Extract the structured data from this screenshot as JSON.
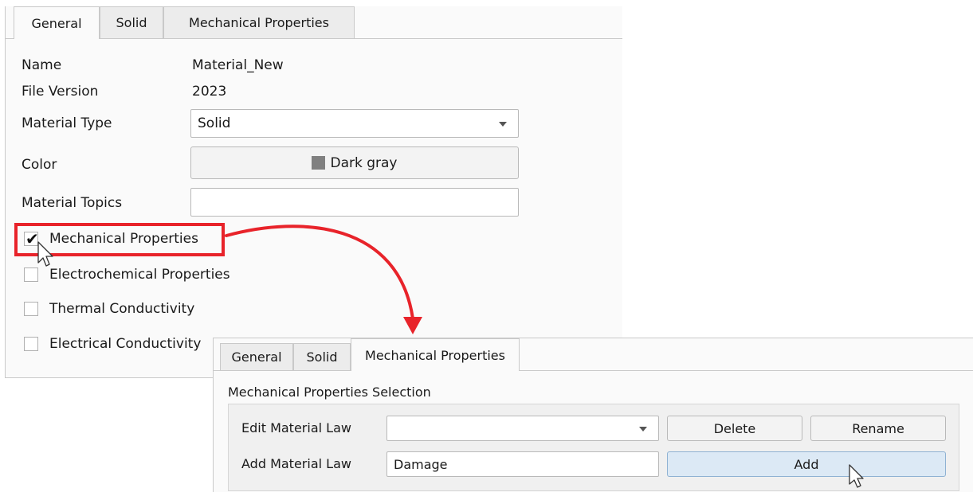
{
  "panel1": {
    "tabs": [
      {
        "label": "General"
      },
      {
        "label": "Solid"
      },
      {
        "label": "Mechanical Properties"
      }
    ],
    "fields": {
      "name_label": "Name",
      "name_value": "Material_New",
      "file_version_label": "File Version",
      "file_version_value": "2023",
      "material_type_label": "Material Type",
      "material_type_value": "Solid",
      "color_label": "Color",
      "color_value": "Dark gray",
      "color_swatch": "#808080",
      "material_topics_label": "Material Topics",
      "material_topics_value": ""
    },
    "checkboxes": [
      {
        "label": "Mechanical Properties",
        "checked": true
      },
      {
        "label": "Electrochemical Properties",
        "checked": false
      },
      {
        "label": "Thermal Conductivity",
        "checked": false
      },
      {
        "label": "Electrical Conductivity",
        "checked": false
      }
    ]
  },
  "panel2": {
    "tabs": [
      {
        "label": "General"
      },
      {
        "label": "Solid"
      },
      {
        "label": "Mechanical Properties"
      }
    ],
    "section_title": "Mechanical Properties Selection",
    "edit_law_label": "Edit Material Law",
    "edit_law_value": "",
    "delete_label": "Delete",
    "rename_label": "Rename",
    "add_law_label": "Add Material Law",
    "add_law_value": "Damage",
    "add_label": "Add"
  },
  "colors": {
    "annotation_red": "#e8232a",
    "add_button_bg": "#dce9f5"
  },
  "icons": [
    "checkmark-icon",
    "dropdown-arrow-icon",
    "mouse-pointer-icon",
    "curved-arrow-icon"
  ]
}
